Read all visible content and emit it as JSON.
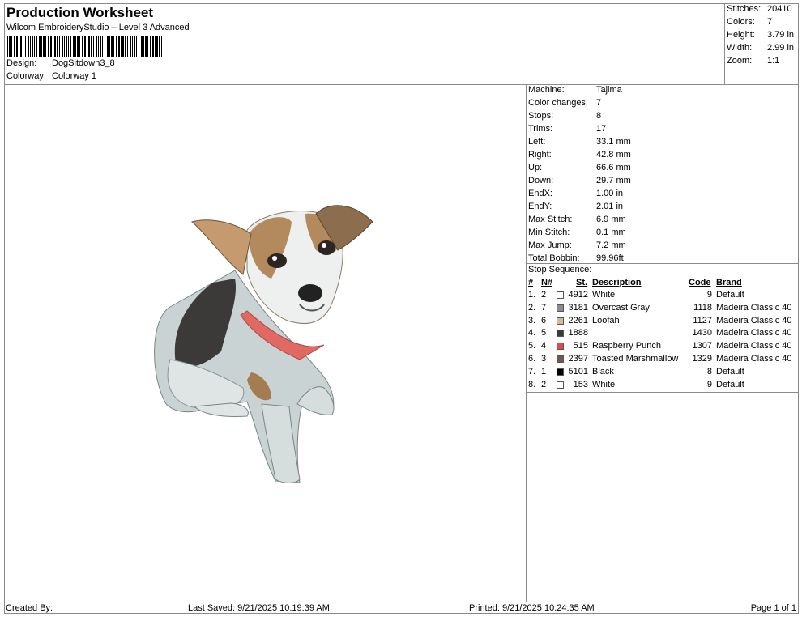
{
  "header": {
    "title": "Production Worksheet",
    "subtitle": "Wilcom EmbroideryStudio – Level 3 Advanced",
    "design_label": "Design:",
    "design_value": "DogSitdown3_8",
    "colorway_label": "Colorway:",
    "colorway_value": "Colorway 1"
  },
  "summary": {
    "stitches_label": "Stitches:",
    "stitches_value": "20410",
    "colors_label": "Colors:",
    "colors_value": "7",
    "height_label": "Height:",
    "height_value": "3.79 in",
    "width_label": "Width:",
    "width_value": "2.99 in",
    "zoom_label": "Zoom:",
    "zoom_value": "1:1"
  },
  "machine_info": [
    {
      "label": "Machine:",
      "value": "Tajima"
    },
    {
      "label": "Color changes:",
      "value": "7"
    },
    {
      "label": "Stops:",
      "value": "8"
    },
    {
      "label": "Trims:",
      "value": "17"
    },
    {
      "label": "Left:",
      "value": "33.1 mm"
    },
    {
      "label": "Right:",
      "value": "42.8 mm"
    },
    {
      "label": "Up:",
      "value": "66.6 mm"
    },
    {
      "label": "Down:",
      "value": "29.7 mm"
    },
    {
      "label": "EndX:",
      "value": "1.00 in"
    },
    {
      "label": "EndY:",
      "value": "2.01 in"
    },
    {
      "label": "Max Stitch:",
      "value": "6.9 mm"
    },
    {
      "label": "Min Stitch:",
      "value": "0.1 mm"
    },
    {
      "label": "Max Jump:",
      "value": "7.2 mm"
    },
    {
      "label": "Total Bobbin:",
      "value": "99.96ft"
    }
  ],
  "stop_sequence": {
    "title": "Stop Sequence:",
    "headers": {
      "num": "#",
      "n": "N#",
      "st": "St.",
      "desc": "Description",
      "code": "Code",
      "brand": "Brand"
    },
    "rows": [
      {
        "num": "1.",
        "n": "2",
        "color": "#ffffff",
        "st": "4912",
        "desc": "White",
        "code": "9",
        "brand": "Default"
      },
      {
        "num": "2.",
        "n": "7",
        "color": "#8c8c8c",
        "st": "3181",
        "desc": "Overcast Gray",
        "code": "1118",
        "brand": "Madeira Classic 40"
      },
      {
        "num": "3.",
        "n": "6",
        "color": "#d9b89a",
        "st": "2261",
        "desc": "Loofah",
        "code": "1127",
        "brand": "Madeira Classic 40"
      },
      {
        "num": "4.",
        "n": "5",
        "color": "#3a3a3a",
        "st": "1888",
        "desc": "",
        "code": "1430",
        "brand": "Madeira Classic 40"
      },
      {
        "num": "5.",
        "n": "4",
        "color": "#e04a4a",
        "st": "515",
        "desc": "Raspberry Punch",
        "code": "1307",
        "brand": "Madeira Classic 40"
      },
      {
        "num": "6.",
        "n": "3",
        "color": "#6e5a50",
        "st": "2397",
        "desc": "Toasted Marshmallow",
        "code": "1329",
        "brand": "Madeira Classic 40"
      },
      {
        "num": "7.",
        "n": "1",
        "color": "#000000",
        "st": "5101",
        "desc": "Black",
        "code": "8",
        "brand": "Default"
      },
      {
        "num": "8.",
        "n": "2",
        "color": "#ffffff",
        "st": "153",
        "desc": "White",
        "code": "9",
        "brand": "Default"
      }
    ]
  },
  "footer": {
    "created_by": "Created By:",
    "last_saved": "Last Saved: 9/21/2025 10:19:39 AM",
    "printed": "Printed: 9/21/2025 10:24:35 AM",
    "page": "Page 1 of 1"
  }
}
